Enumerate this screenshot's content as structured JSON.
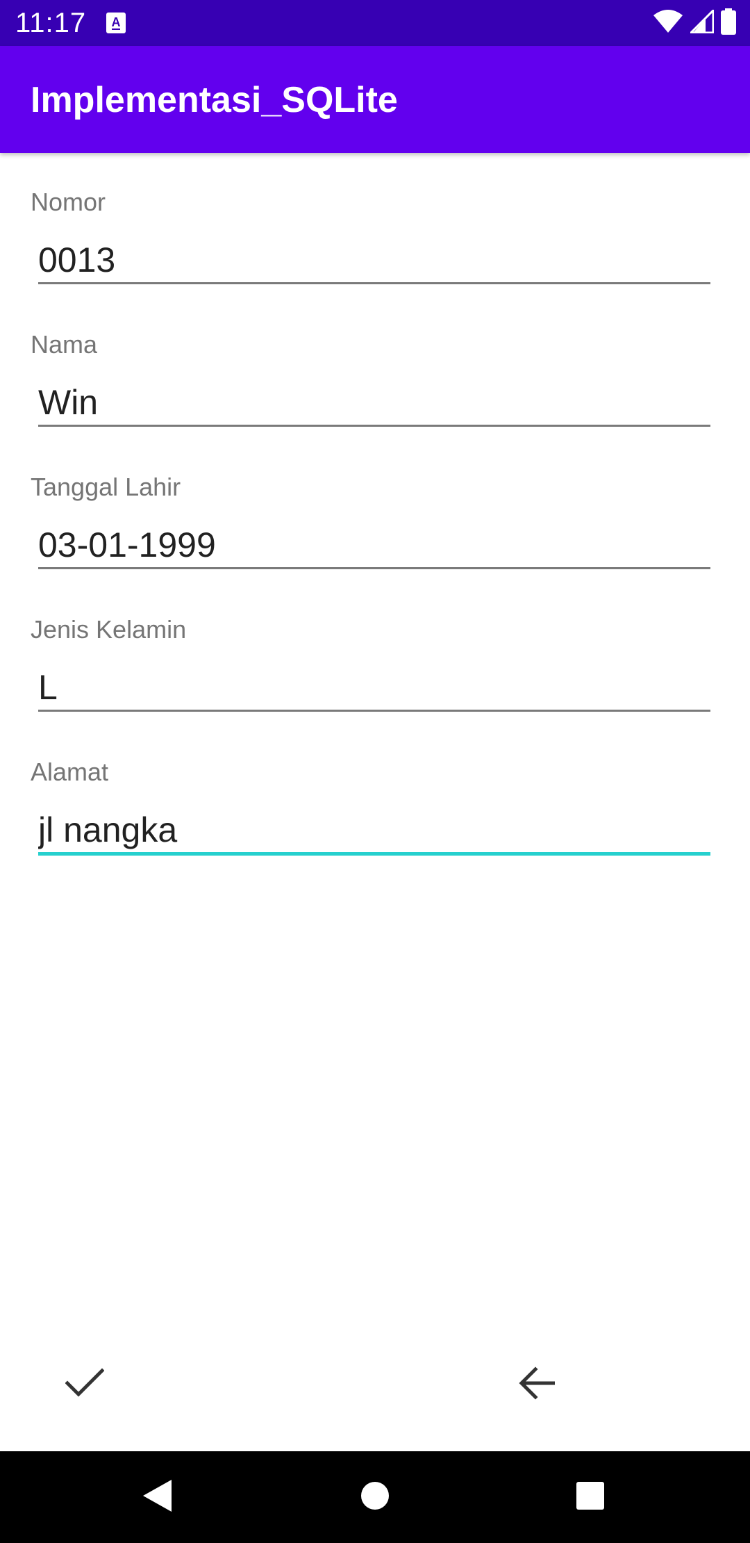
{
  "status_bar": {
    "time": "11:17",
    "icons": [
      "notification-a-icon",
      "wifi-icon",
      "signal-icon",
      "battery-icon"
    ]
  },
  "app_bar": {
    "title": "Implementasi_SQLite"
  },
  "form": {
    "fields": [
      {
        "label": "Nomor",
        "value": "0013"
      },
      {
        "label": "Nama",
        "value": "Win"
      },
      {
        "label": "Tanggal Lahir",
        "value": "03-01-1999"
      },
      {
        "label": "Jenis Kelamin",
        "value": "L"
      },
      {
        "label": "Alamat",
        "value": "jl nangka"
      }
    ]
  },
  "actions": {
    "save_icon": "check-icon",
    "back_icon": "arrow-back-icon"
  },
  "nav_bar": {
    "icons": [
      "nav-back-icon",
      "nav-home-icon",
      "nav-recents-icon"
    ]
  },
  "colors": {
    "status_bar": "#3700B3",
    "app_bar": "#6200EE",
    "focus_underline": "#26D0CE",
    "label_text": "#757575"
  }
}
